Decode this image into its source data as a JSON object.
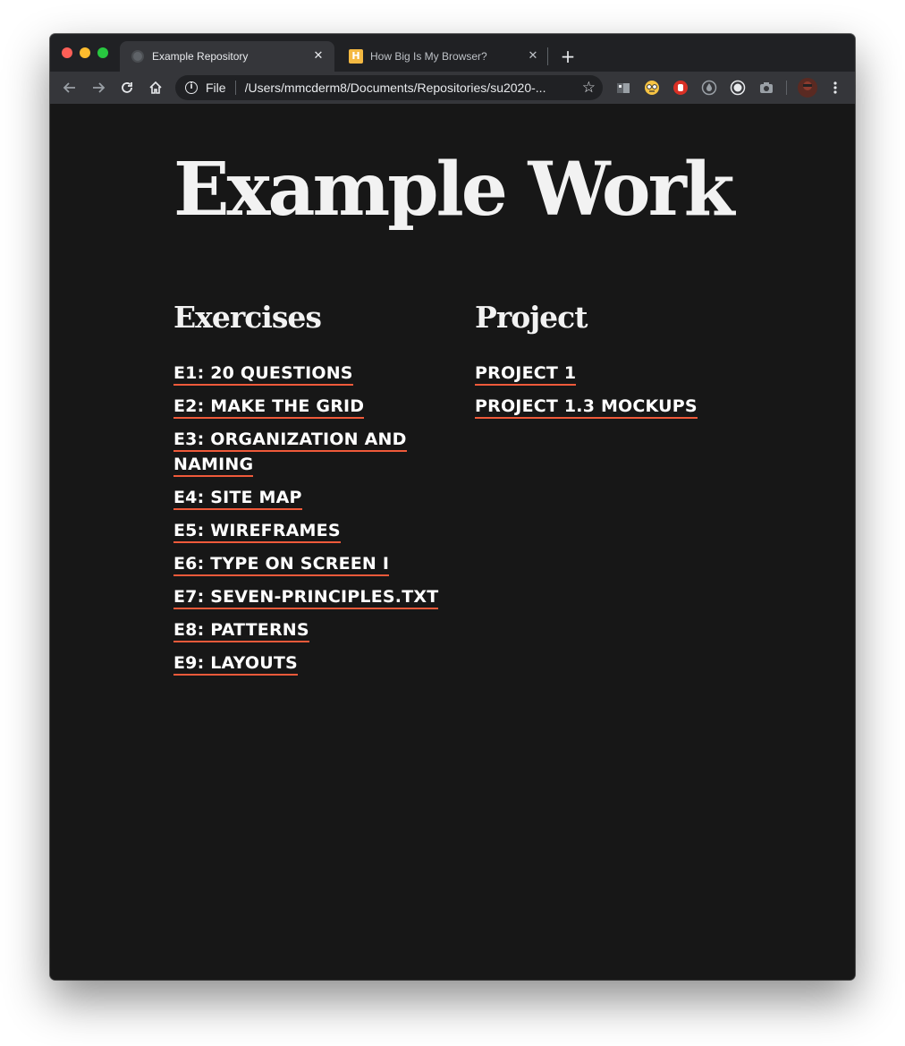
{
  "browser": {
    "tabs": [
      {
        "title": "Example Repository",
        "active": true
      },
      {
        "title": "How Big Is My Browser?",
        "active": false
      }
    ],
    "address": {
      "scheme_label": "File",
      "url": "/Users/mmcderm8/Documents/Repositories/su2020-..."
    },
    "colors": {
      "tab_bg": "#202124",
      "toolbar_bg": "#35363a"
    }
  },
  "page": {
    "title": "Example Work",
    "accent_color": "#ef5a3a",
    "exercises": {
      "heading": "Exercises",
      "links": [
        "E1: 20 QUESTIONS",
        "E2: MAKE THE GRID",
        "E3: ORGANIZATION AND NAMING",
        "E4: SITE MAP",
        "E5: WIREFRAMES",
        "E6: TYPE ON SCREEN I",
        "E7: SEVEN-PRINCIPLES.TXT",
        "E8: PATTERNS",
        "E9: LAYOUTS"
      ]
    },
    "project": {
      "heading": "Project",
      "links": [
        "PROJECT 1",
        "PROJECT 1.3 MOCKUPS"
      ]
    }
  }
}
